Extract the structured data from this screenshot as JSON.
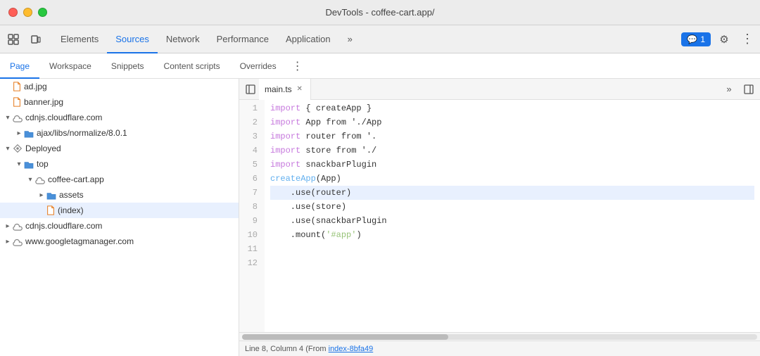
{
  "window": {
    "title": "DevTools - coffee-cart.app/"
  },
  "main_tabs": [
    {
      "label": "Elements",
      "active": false
    },
    {
      "label": "Sources",
      "active": true
    },
    {
      "label": "Network",
      "active": false
    },
    {
      "label": "Performance",
      "active": false
    },
    {
      "label": "Application",
      "active": false
    },
    {
      "label": "»",
      "active": false
    }
  ],
  "toolbar": {
    "chat_label": "1",
    "more_icon": "⋮"
  },
  "sub_tabs": [
    {
      "label": "Page",
      "active": true
    },
    {
      "label": "Workspace",
      "active": false
    },
    {
      "label": "Snippets",
      "active": false
    },
    {
      "label": "Content scripts",
      "active": false
    },
    {
      "label": "Overrides",
      "active": false
    }
  ],
  "file_tree": [
    {
      "indent": 0,
      "arrow": "none",
      "icon": "📄",
      "icon_color": "#e67e22",
      "name": "ad.jpg"
    },
    {
      "indent": 0,
      "arrow": "none",
      "icon": "📄",
      "icon_color": "#e67e22",
      "name": "banner.jpg"
    },
    {
      "indent": 0,
      "arrow": "open",
      "icon": "☁",
      "icon_color": "#888",
      "name": "cdnjs.cloudflare.com"
    },
    {
      "indent": 1,
      "arrow": "closed",
      "icon": "📁",
      "icon_color": "#4a90d9",
      "name": "ajax/libs/normalize/8.0.1"
    },
    {
      "indent": 0,
      "arrow": "open",
      "icon": "◈",
      "icon_color": "#888",
      "name": "Deployed"
    },
    {
      "indent": 1,
      "arrow": "open",
      "icon": "📁",
      "icon_color": "#888",
      "name": "top"
    },
    {
      "indent": 2,
      "arrow": "open",
      "icon": "☁",
      "icon_color": "#888",
      "name": "coffee-cart.app"
    },
    {
      "indent": 3,
      "arrow": "closed",
      "icon": "📁",
      "icon_color": "#4a90d9",
      "name": "assets"
    },
    {
      "indent": 3,
      "arrow": "none",
      "icon": "📄",
      "icon_color": "#888",
      "name": "(index)",
      "selected": true
    },
    {
      "indent": 0,
      "arrow": "closed",
      "icon": "☁",
      "icon_color": "#888",
      "name": "cdnjs.cloudflare.com"
    },
    {
      "indent": 0,
      "arrow": "closed",
      "icon": "☁",
      "icon_color": "#888",
      "name": "www.googletagmanager.com"
    }
  ],
  "code_editor": {
    "filename": "main.ts",
    "lines": [
      {
        "num": 1,
        "tokens": [
          {
            "t": "kw",
            "v": "import"
          },
          {
            "t": "plain",
            "v": " { createApp } "
          }
        ]
      },
      {
        "num": 2,
        "tokens": [
          {
            "t": "kw",
            "v": "import"
          },
          {
            "t": "plain",
            "v": " App from './App"
          }
        ]
      },
      {
        "num": 3,
        "tokens": [
          {
            "t": "kw",
            "v": "import"
          },
          {
            "t": "plain",
            "v": " router from '."
          }
        ]
      },
      {
        "num": 4,
        "tokens": [
          {
            "t": "kw",
            "v": "import"
          },
          {
            "t": "plain",
            "v": " store from './"
          }
        ]
      },
      {
        "num": 5,
        "tokens": [
          {
            "t": "kw",
            "v": "import"
          },
          {
            "t": "plain",
            "v": " snackbarPlugin"
          }
        ]
      },
      {
        "num": 6,
        "tokens": [
          {
            "t": "plain",
            "v": ""
          }
        ]
      },
      {
        "num": 7,
        "tokens": [
          {
            "t": "fn",
            "v": "createApp"
          },
          {
            "t": "plain",
            "v": "(App)"
          }
        ]
      },
      {
        "num": 8,
        "tokens": [
          {
            "t": "plain",
            "v": "    .use(router)"
          }
        ],
        "highlighted": true
      },
      {
        "num": 9,
        "tokens": [
          {
            "t": "plain",
            "v": "    .use(store)"
          }
        ]
      },
      {
        "num": 10,
        "tokens": [
          {
            "t": "plain",
            "v": "    .use(snackbarPlugin"
          }
        ]
      },
      {
        "num": 11,
        "tokens": [
          {
            "t": "plain",
            "v": "    .mount("
          },
          {
            "t": "str",
            "v": "'#app'"
          },
          {
            "t": "plain",
            "v": ")"
          }
        ]
      },
      {
        "num": 12,
        "tokens": [
          {
            "t": "plain",
            "v": ""
          }
        ]
      }
    ]
  },
  "status_bar": {
    "text": "Line 8, Column 4",
    "from_text": "(From",
    "link_text": "index-8bfa49",
    "suffix": ""
  }
}
